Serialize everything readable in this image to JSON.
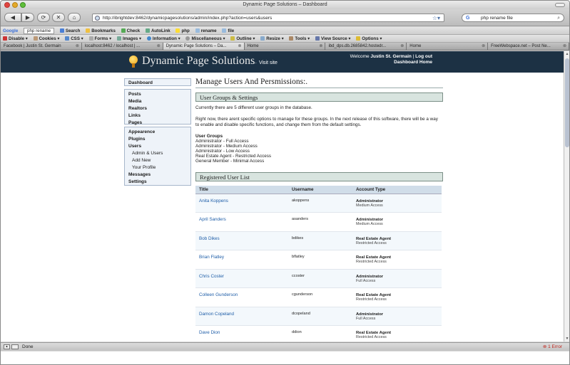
{
  "browser": {
    "title": "Dynamic Page Solutions – Dashboard",
    "url": "http://ibrightdev:8462/dynamicpagesolutions/admin/index.php?action=users&users",
    "search": "php rename file",
    "status": "Done",
    "errors": "1 Error"
  },
  "toolbar1": [
    "Google",
    "php rename",
    "Search",
    "Bookmarks",
    "Check",
    "AutoLink",
    "php",
    "rename",
    "file"
  ],
  "toolbar2": [
    "Disable",
    "Cookies",
    "CSS",
    "Forms",
    "Images",
    "Information",
    "Miscellaneous",
    "Outline",
    "Resize",
    "Tools",
    "View Source",
    "Options"
  ],
  "tabs": [
    "Facebook | Justin St. Germain",
    "localhost:8462 / localhost | ...",
    "Dynamic Page Solutions – Da...",
    "Home",
    "ibd_dps.db.2685842.hostedr...",
    "Home",
    "FreeWebspace.net – Post Ne..."
  ],
  "site": {
    "name": "Dynamic Page Solutions",
    "visit": "← Visit site",
    "welcome_prefix": "Welcome ",
    "user": "Justin St. Germain",
    "logout": "Log out",
    "dashboard_home": "Dashboard Home"
  },
  "sidebar": {
    "dashboard": "Dashboard",
    "group1": [
      "Posts",
      "Media",
      "Realtors",
      "Links",
      "Pages"
    ],
    "group2": [
      "Appearence",
      "Plugins",
      "Users"
    ],
    "users_sub": [
      "Admin & Users",
      "Add New",
      "Your Profile"
    ],
    "group3": [
      "Messages",
      "Settings"
    ]
  },
  "main": {
    "heading": "Manage Users And Persmissions:.",
    "groups_box": "User Groups & Settings",
    "p1": "Currently there are 5 different user groups in the database.",
    "p2": "Right now, there arent specific options to manage for these groups. In the next release of this software, there will be a way to enable and disable specific functions, and change them from the default settings.",
    "groups_title": "User Groups",
    "groups": [
      "Administrator - Full Access",
      "Administrator - Medium Access",
      "Administrator - Low Access",
      "Real Estate Agent - Restricted Access",
      "General Member - Minimal Access"
    ],
    "list_box": "Registered User List",
    "columns": [
      "Title",
      "Username",
      "Account Type"
    ],
    "users": [
      {
        "name": "Anita Koppens",
        "username": "akoppens",
        "type": "Administrator",
        "access": "Medium Access"
      },
      {
        "name": "April Sanders",
        "username": "asanders",
        "type": "Administrator",
        "access": "Medium Access"
      },
      {
        "name": "Bob Dikes",
        "username": "bdikes",
        "type": "Real Estate Agent",
        "access": "Restricted Access"
      },
      {
        "name": "Brian Flatley",
        "username": "bflatley",
        "type": "Real Estate Agent",
        "access": "Restricted Access"
      },
      {
        "name": "Chris Coster",
        "username": "ccoster",
        "type": "Administrator",
        "access": "Full Access"
      },
      {
        "name": "Colleen Gunderson",
        "username": "cgunderson",
        "type": "Real Estate Agent",
        "access": "Restricted Access"
      },
      {
        "name": "Damon Copeland",
        "username": "dcopeland",
        "type": "Administrator",
        "access": "Full Access"
      },
      {
        "name": "Dave Dion",
        "username": "ddion",
        "type": "Real Estate Agent",
        "access": "Restricted Access"
      }
    ]
  }
}
